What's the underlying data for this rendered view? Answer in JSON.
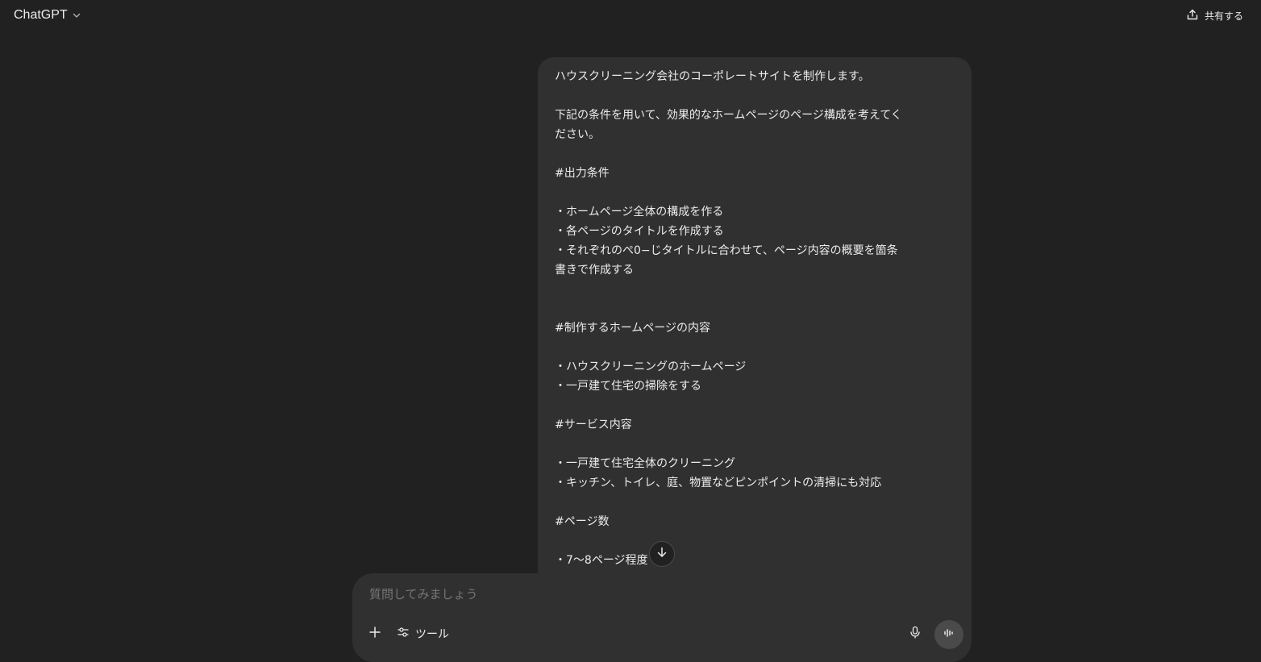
{
  "header": {
    "model_name": "ChatGPT",
    "share_label": "共有する"
  },
  "message": {
    "lines": [
      "ハウスクリーニング会社のコーポレートサイトを制作します。",
      "",
      "下記の条件を用いて、効果的なホームページのページ構成を考えてく",
      "ださい。",
      "",
      "#出力条件",
      "",
      "・ホームページ全体の構成を作る",
      "・各ページのタイトルを作成する",
      "・それぞれのぺ0−じタイトルに合わせて、ページ内容の概要を箇条",
      "書きで作成する",
      "",
      "",
      "#制作するホームページの内容",
      "",
      "・ハウスクリーニングのホームページ",
      "・一戸建て住宅の掃除をする",
      "",
      "#サービス内容",
      "",
      "・一戸建て住宅全体のクリーニング",
      "・キッチン、トイレ、庭、物置などピンポイントの清掃にも対応",
      "",
      "#ページ数",
      "",
      "・7〜8ページ程度"
    ]
  },
  "composer": {
    "placeholder": "質問してみましょう",
    "tools_label": "ツール"
  },
  "icons": {
    "model_switch": "chevron-down-icon",
    "share": "share-icon",
    "scroll": "arrow-down-icon",
    "plus": "plus-icon",
    "tools": "sliders-icon",
    "mic": "microphone-icon",
    "voice": "voice-waveform-icon"
  }
}
